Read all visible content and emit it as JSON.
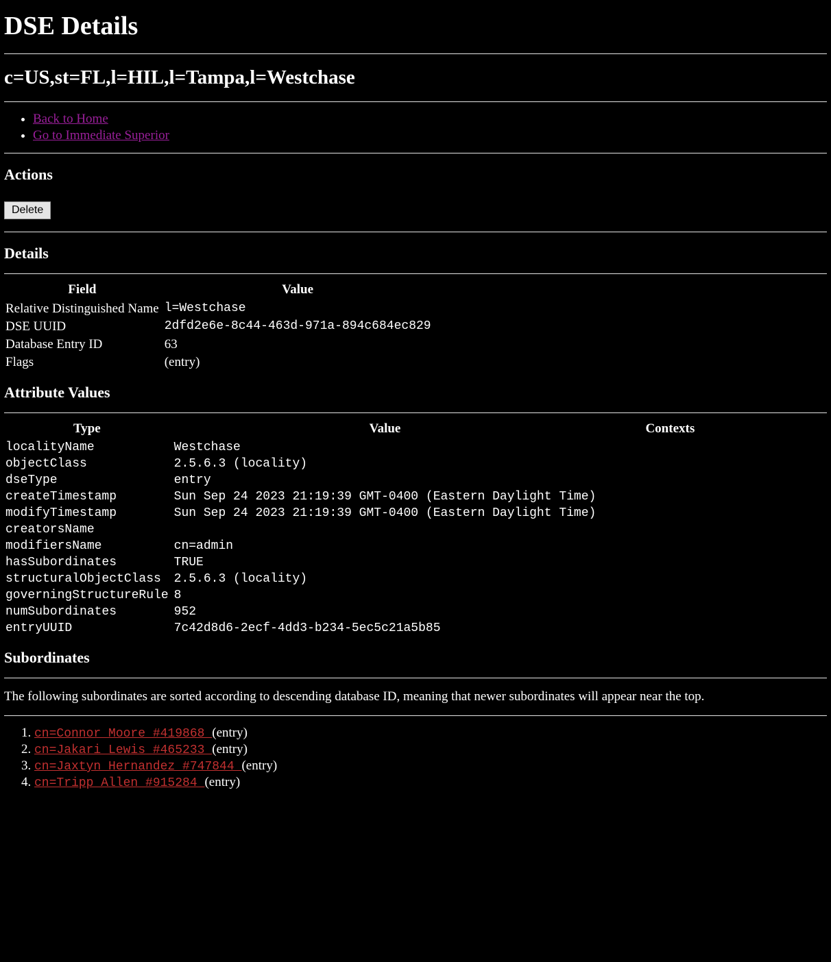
{
  "page": {
    "title": "DSE Details",
    "dn": "c=US,st=FL,l=HIL,l=Tampa,l=Westchase"
  },
  "nav": {
    "back_home": "Back to Home",
    "go_superior": "Go to Immediate Superior"
  },
  "sections": {
    "actions": "Actions",
    "details": "Details",
    "attribute_values": "Attribute Values",
    "subordinates": "Subordinates"
  },
  "actions": {
    "delete_label": "Delete"
  },
  "details_table": {
    "headers": {
      "field": "Field",
      "value": "Value"
    },
    "rows": [
      {
        "field": "Relative Distinguished Name",
        "value": "l=Westchase",
        "mono": true
      },
      {
        "field": "DSE UUID",
        "value": "2dfd2e6e-8c44-463d-971a-894c684ec829",
        "mono": true
      },
      {
        "field": "Database Entry ID",
        "value": "63",
        "mono": false
      },
      {
        "field": "Flags",
        "value": "(entry)",
        "mono": false
      }
    ]
  },
  "attributes_table": {
    "headers": {
      "type": "Type",
      "value": "Value",
      "contexts": "Contexts"
    },
    "rows": [
      {
        "type": "localityName",
        "value": "Westchase",
        "contexts": ""
      },
      {
        "type": "objectClass",
        "value": "2.5.6.3 (locality)",
        "contexts": ""
      },
      {
        "type": "dseType",
        "value": "entry",
        "contexts": ""
      },
      {
        "type": "createTimestamp",
        "value": "Sun Sep 24 2023 21:19:39 GMT-0400 (Eastern Daylight Time)",
        "contexts": ""
      },
      {
        "type": "modifyTimestamp",
        "value": "Sun Sep 24 2023 21:19:39 GMT-0400 (Eastern Daylight Time)",
        "contexts": ""
      },
      {
        "type": "creatorsName",
        "value": "",
        "contexts": ""
      },
      {
        "type": "modifiersName",
        "value": "cn=admin",
        "contexts": ""
      },
      {
        "type": "hasSubordinates",
        "value": "TRUE",
        "contexts": ""
      },
      {
        "type": "structuralObjectClass",
        "value": "2.5.6.3 (locality)",
        "contexts": ""
      },
      {
        "type": "governingStructureRule",
        "value": "8",
        "contexts": ""
      },
      {
        "type": "numSubordinates",
        "value": "952",
        "contexts": ""
      },
      {
        "type": "entryUUID",
        "value": "7c42d8d6-2ecf-4dd3-b234-5ec5c21a5b85",
        "contexts": ""
      }
    ]
  },
  "subordinates": {
    "intro": "The following subordinates are sorted according to descending database ID, meaning that newer subordinates will appear near the top.",
    "items": [
      {
        "cn": "cn=Connor Moore #419868 ",
        "flag": "(entry)"
      },
      {
        "cn": "cn=Jakari Lewis #465233 ",
        "flag": "(entry)"
      },
      {
        "cn": "cn=Jaxtyn Hernandez #747844 ",
        "flag": "(entry)"
      },
      {
        "cn": "cn=Tripp Allen #915284 ",
        "flag": "(entry)"
      }
    ]
  }
}
